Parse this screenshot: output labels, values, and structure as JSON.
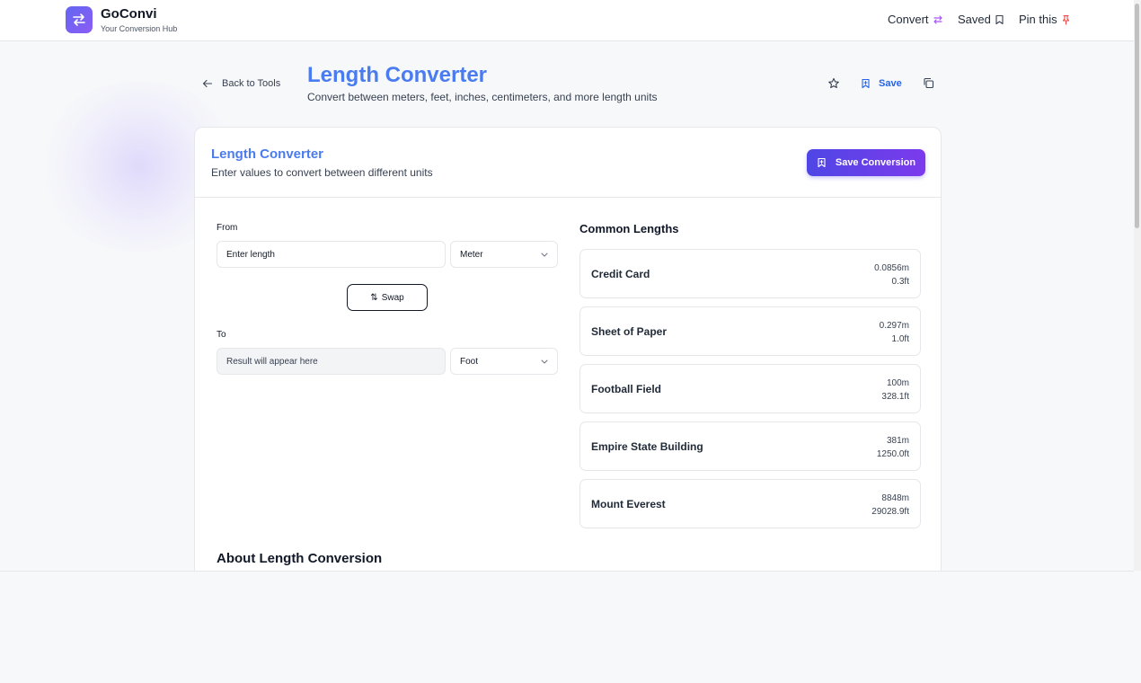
{
  "brand": {
    "name": "GoConvi",
    "tagline": "Your Conversion Hub"
  },
  "nav": {
    "convert": "Convert",
    "saved": "Saved",
    "pin": "Pin this"
  },
  "page": {
    "back_label": "Back to Tools",
    "title": "Length Converter",
    "subtitle": "Convert between meters, feet, inches, centimeters, and more length units",
    "save_label": "Save"
  },
  "card": {
    "title": "Length Converter",
    "subtitle": "Enter values to convert between different units",
    "save_button": "Save Conversion"
  },
  "converter": {
    "from_label": "From",
    "from_placeholder": "Enter length",
    "from_unit": "Meter",
    "swap_label": "Swap",
    "to_label": "To",
    "to_placeholder": "Result will appear here",
    "to_unit": "Foot"
  },
  "common": {
    "title": "Common Lengths",
    "items": [
      {
        "name": "Credit Card",
        "meters": "0.0856m",
        "feet": "0.3ft"
      },
      {
        "name": "Sheet of Paper",
        "meters": "0.297m",
        "feet": "1.0ft"
      },
      {
        "name": "Football Field",
        "meters": "100m",
        "feet": "328.1ft"
      },
      {
        "name": "Empire State Building",
        "meters": "381m",
        "feet": "1250.0ft"
      },
      {
        "name": "Mount Everest",
        "meters": "8848m",
        "feet": "29028.9ft"
      }
    ]
  },
  "about": {
    "title": "About Length Conversion"
  },
  "colors": {
    "accent": "#4a7cf0",
    "brand_gradient_start": "#4f46e5",
    "brand_gradient_end": "#7c3aed",
    "pin": "#ef4444",
    "convert_icon": "#a855f7"
  }
}
